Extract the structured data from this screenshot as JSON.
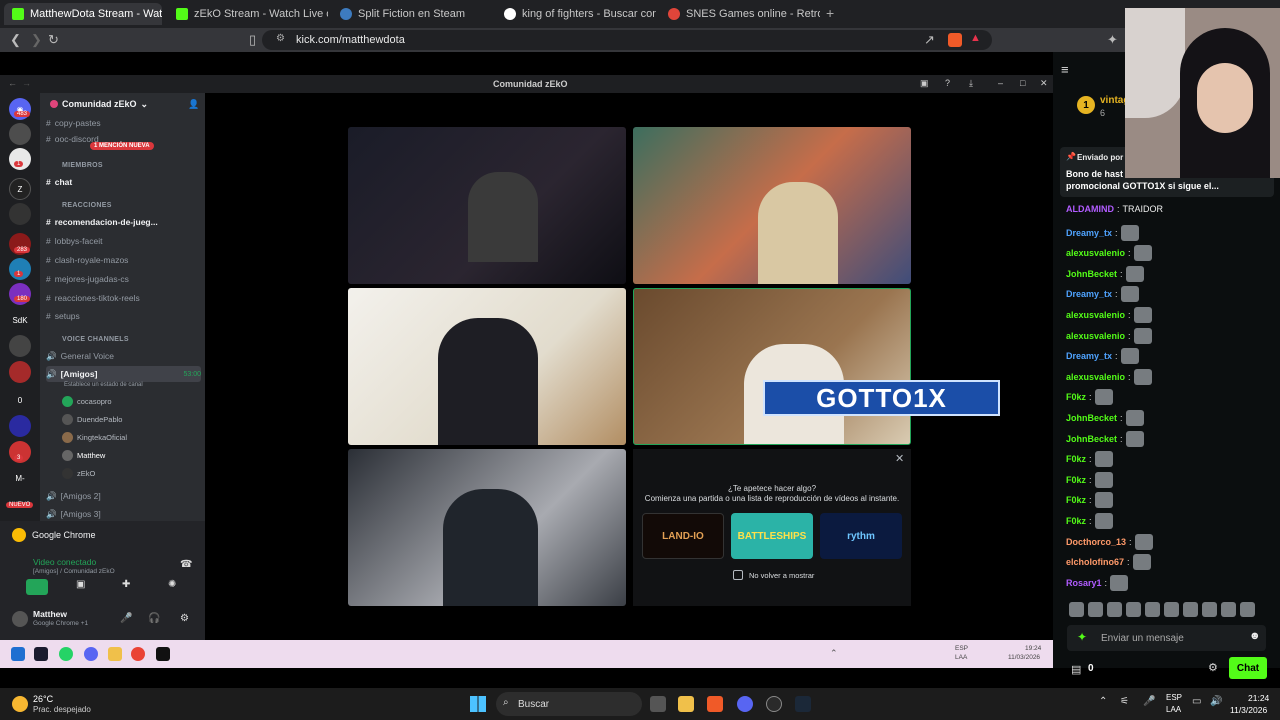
{
  "browser": {
    "tabs": [
      {
        "title": "MatthewDota Stream - Watc",
        "active": true,
        "favicon_color": "#53fc18"
      },
      {
        "title": "zEkO Stream - Watch Live on Kick",
        "favicon_color": "#53fc18"
      },
      {
        "title": "Split Fiction en Steam",
        "favicon_color": "#3d7bbf"
      },
      {
        "title": "king of fighters - Buscar con Google",
        "favicon_color": "#ffffff"
      },
      {
        "title": "SNES Games online - RetroGames.cc",
        "favicon_color": "#e0453a"
      }
    ],
    "new_tab": "+",
    "url": "kick.com/matthewdota"
  },
  "discord": {
    "window_title": "Comunidad zEkO",
    "server_name": "Comunidad zEkO",
    "mention_badge": "1 MENCIÓN NUEVA",
    "guild_badges": [
      "483",
      "1",
      "283",
      "1",
      "180",
      "3"
    ],
    "guild_labels": [
      "SdK",
      "0",
      "M-",
      "NUEVO"
    ],
    "channels": [
      {
        "name": "copy-pastes",
        "type": "text"
      },
      {
        "name": "ooc-discord",
        "type": "text"
      },
      {
        "category": "MIEMBROS"
      },
      {
        "name": "chat",
        "type": "text",
        "bold": true
      },
      {
        "category": "REACCIONES"
      },
      {
        "name": "recomendacion-de-jueg...",
        "type": "text",
        "bold": true
      },
      {
        "name": "lobbys-faceit",
        "type": "text"
      },
      {
        "name": "clash-royale-mazos",
        "type": "text"
      },
      {
        "name": "mejores-jugadas-cs",
        "type": "text"
      },
      {
        "name": "reacciones-tiktok-reels",
        "type": "text"
      },
      {
        "name": "setups",
        "type": "text"
      },
      {
        "category": "VOICE CHANNELS"
      },
      {
        "name": "General Voice",
        "type": "voice"
      },
      {
        "name": "[Amigos]",
        "type": "voice",
        "bold": true,
        "timer": "53:00"
      },
      {
        "name": "[Amigos 2]",
        "type": "voice"
      },
      {
        "name": "[Amigos 3]",
        "type": "voice"
      }
    ],
    "status_hint": "Establece un estado de canal",
    "voice_users": [
      "cocasopro",
      "DuendePablo",
      "KingtekaOficial",
      "Matthew",
      "zEkO"
    ],
    "app_activity": "Google Chrome",
    "voice_connected": "Video conectado",
    "voice_location": "[Amigos] / Comunidad zEkO",
    "user_name": "Matthew",
    "user_status": "Google Chrome +1",
    "overlay_name": "GOTTO1X",
    "activity": {
      "title": "¿Te apetece hacer algo?",
      "subtitle": "Comienza una partida o una lista de reproducción de vídeos al instante.",
      "games": [
        "LAND-IO",
        "BATTLESHIPS",
        "rythm"
      ],
      "dont_show": "No volver a mostrar"
    }
  },
  "innertaskbar": {
    "lang": "ESP",
    "lang2": "LAA",
    "time": "19:24",
    "date": "11/03/2026"
  },
  "chat": {
    "pinned_user": "vintag",
    "pinned_count": "6",
    "pinned_by": "Enviado por",
    "pinned_text": "Bono de hast",
    "pinned_text2": "promocional GOTTO1X si sigue el...",
    "messages": [
      {
        "user": "ALDAMIND",
        "text": "TRAIDOR",
        "color": "#b15cff"
      },
      {
        "user": "Dreamy_tx",
        "color": "#4fa3ff"
      },
      {
        "user": "alexusvalenio",
        "color": "#53fc18"
      },
      {
        "user": "JohnBecket",
        "color": "#53fc18"
      },
      {
        "user": "Dreamy_tx",
        "color": "#4fa3ff"
      },
      {
        "user": "alexusvalenio",
        "color": "#53fc18"
      },
      {
        "user": "alexusvalenio",
        "color": "#53fc18"
      },
      {
        "user": "Dreamy_tx",
        "color": "#4fa3ff"
      },
      {
        "user": "alexusvalenio",
        "color": "#53fc18"
      },
      {
        "user": "F0kz",
        "color": "#53fc18"
      },
      {
        "user": "JohnBecket",
        "color": "#53fc18"
      },
      {
        "user": "JohnBecket",
        "color": "#53fc18"
      },
      {
        "user": "F0kz",
        "color": "#53fc18"
      },
      {
        "user": "F0kz",
        "color": "#53fc18"
      },
      {
        "user": "F0kz",
        "color": "#53fc18"
      },
      {
        "user": "F0kz",
        "color": "#53fc18"
      },
      {
        "user": "Docthorco_13",
        "color": "#ff9a6a"
      },
      {
        "user": "elcholofino67",
        "color": "#ff9a6a"
      },
      {
        "user": "Rosary1",
        "color": "#b15cff"
      }
    ],
    "input_placeholder": "Enviar un mensaje",
    "balance": "0",
    "send_label": "Chat"
  },
  "taskbar": {
    "weather_temp": "26°C",
    "weather_desc": "Prac. despejado",
    "search": "Buscar",
    "lang": "ESP",
    "lang2": "LAA",
    "time": "21:24",
    "date": "11/3/2026"
  }
}
